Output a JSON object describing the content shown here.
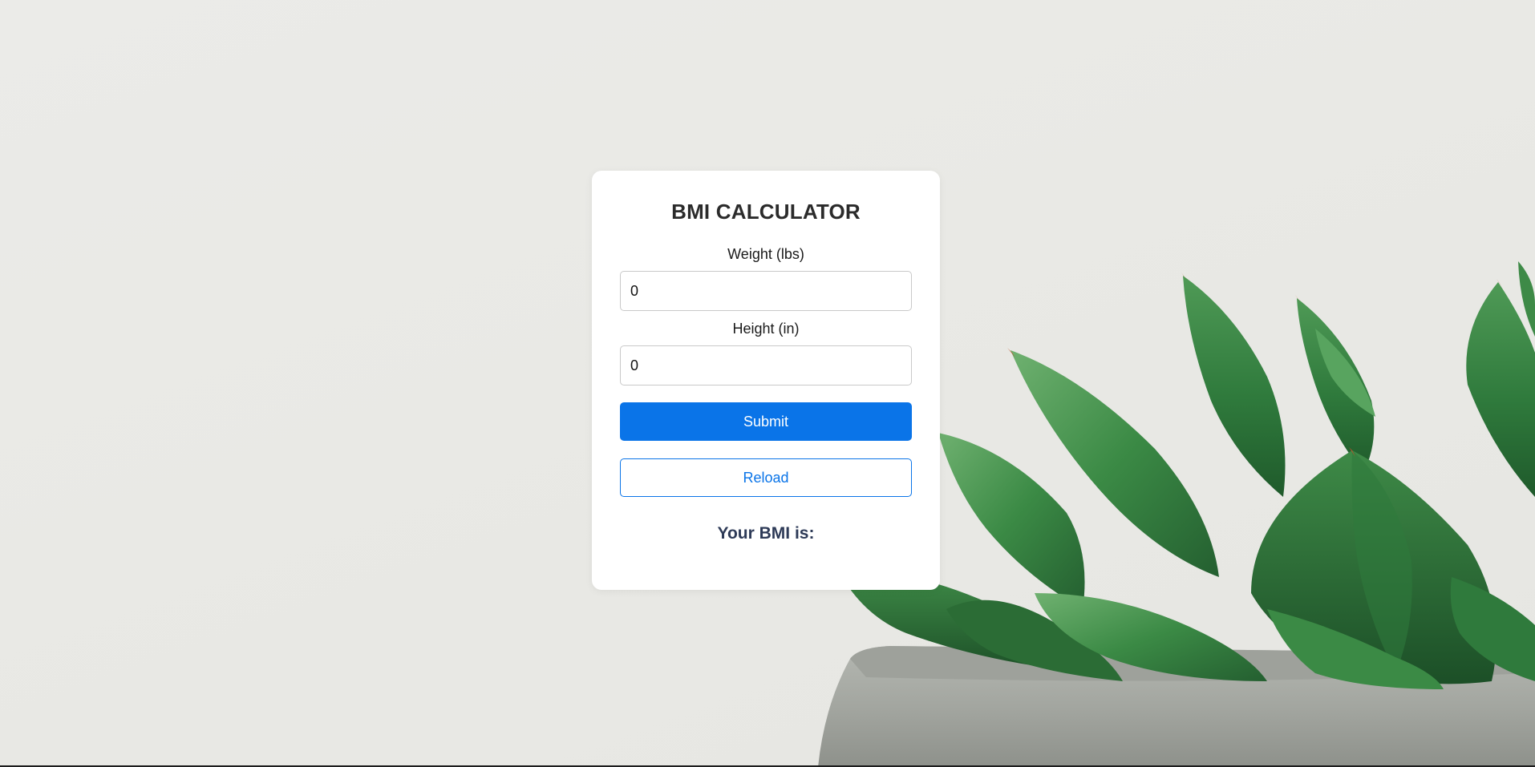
{
  "card": {
    "title": "BMI CALCULATOR",
    "weight_label": "Weight (lbs)",
    "weight_value": "0",
    "height_label": "Height (in)",
    "height_value": "0",
    "submit_label": "Submit",
    "reload_label": "Reload",
    "result_text": "Your BMI is:"
  },
  "colors": {
    "accent": "#0a74e8",
    "result_text": "#2d3a57",
    "background": "#e9e9e5"
  },
  "background_image": "succulent-plant-in-concrete-pot"
}
